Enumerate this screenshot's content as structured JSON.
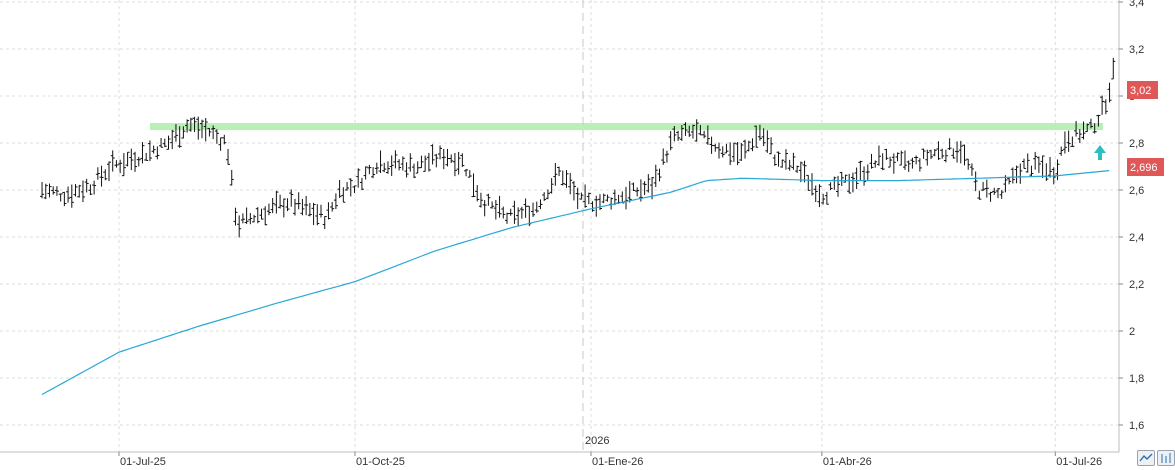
{
  "chart_data": {
    "type": "line",
    "subtype": "ohlc-bars-with-moving-average",
    "title": "",
    "xlabel": "",
    "ylabel": "",
    "ylim": [
      1.5,
      3.4
    ],
    "grid": true,
    "y_axis_side": "right",
    "y_ticks": [
      "1,6",
      "1,8",
      "2",
      "2,2",
      "2,4",
      "2,6",
      "2,8",
      "3",
      "3,2",
      "3,4"
    ],
    "x_ticks": [
      "01-Jul-25",
      "01-Oct-25",
      "01-Ene-26",
      "01-Abr-26",
      "01-Jul-26"
    ],
    "year_marker": "2026",
    "price_anchors": [
      [
        "2025-06-01",
        2.6
      ],
      [
        "2025-06-10",
        2.58
      ],
      [
        "2025-06-20",
        2.62
      ],
      [
        "2025-06-28",
        2.7
      ],
      [
        "2025-07-10",
        2.75
      ],
      [
        "2025-07-20",
        2.8
      ],
      [
        "2025-07-28",
        2.88
      ],
      [
        "2025-08-05",
        2.85
      ],
      [
        "2025-08-12",
        2.8
      ],
      [
        "2025-08-16",
        2.45
      ],
      [
        "2025-08-25",
        2.5
      ],
      [
        "2025-09-05",
        2.55
      ],
      [
        "2025-09-20",
        2.48
      ],
      [
        "2025-09-25",
        2.6
      ],
      [
        "2025-10-01",
        2.62
      ],
      [
        "2025-10-10",
        2.72
      ],
      [
        "2025-10-25",
        2.7
      ],
      [
        "2025-11-05",
        2.75
      ],
      [
        "2025-11-12",
        2.72
      ],
      [
        "2025-11-20",
        2.55
      ],
      [
        "2025-11-30",
        2.48
      ],
      [
        "2025-12-10",
        2.52
      ],
      [
        "2025-12-20",
        2.68
      ],
      [
        "2025-12-28",
        2.55
      ],
      [
        "2026-01-05",
        2.55
      ],
      [
        "2026-01-15",
        2.58
      ],
      [
        "2026-01-25",
        2.62
      ],
      [
        "2026-02-02",
        2.82
      ],
      [
        "2026-02-10",
        2.85
      ],
      [
        "2026-02-20",
        2.78
      ],
      [
        "2026-03-01",
        2.75
      ],
      [
        "2026-03-08",
        2.85
      ],
      [
        "2026-03-15",
        2.72
      ],
      [
        "2026-03-22",
        2.7
      ],
      [
        "2026-04-01",
        2.58
      ],
      [
        "2026-04-05",
        2.6
      ],
      [
        "2026-04-15",
        2.66
      ],
      [
        "2026-04-25",
        2.74
      ],
      [
        "2026-05-05",
        2.7
      ],
      [
        "2026-05-15",
        2.76
      ],
      [
        "2026-05-25",
        2.78
      ],
      [
        "2026-06-01",
        2.6
      ],
      [
        "2026-06-10",
        2.58
      ],
      [
        "2026-06-18",
        2.7
      ],
      [
        "2026-06-25",
        2.7
      ],
      [
        "2026-07-01",
        2.68
      ],
      [
        "2026-07-05",
        2.82
      ],
      [
        "2026-07-15",
        2.86
      ],
      [
        "2026-07-20",
        2.95
      ],
      [
        "2026-07-25",
        3.15
      ],
      [
        "2026-07-30",
        3.28
      ],
      [
        "2026-08-02",
        3.2
      ],
      [
        "2026-08-05",
        3.02
      ]
    ],
    "moving_average_anchors": [
      [
        "2025-06-01",
        1.73
      ],
      [
        "2025-07-01",
        1.91
      ],
      [
        "2025-08-01",
        2.02
      ],
      [
        "2025-09-01",
        2.12
      ],
      [
        "2025-10-01",
        2.21
      ],
      [
        "2025-11-01",
        2.34
      ],
      [
        "2025-12-01",
        2.44
      ],
      [
        "2026-01-01",
        2.52
      ],
      [
        "2026-02-01",
        2.59
      ],
      [
        "2026-02-15",
        2.64
      ],
      [
        "2026-03-01",
        2.65
      ],
      [
        "2026-04-01",
        2.64
      ],
      [
        "2026-05-01",
        2.64
      ],
      [
        "2026-06-01",
        2.65
      ],
      [
        "2026-07-01",
        2.66
      ],
      [
        "2026-08-07",
        2.7
      ]
    ],
    "series": [
      {
        "type": "ohlc",
        "color": "#111111"
      },
      {
        "type": "line",
        "color": "#29a8d6"
      }
    ],
    "annotations": {
      "resistance_line": {
        "value": 2.87,
        "color": "#b9f0b5"
      },
      "up_arrow_color": "#2dbfbf",
      "last_price": {
        "value": 3.02,
        "label": "3,02",
        "color": "#e05757"
      },
      "ma_value": {
        "value": 2.696,
        "label": "2,696",
        "color": "#e05757"
      }
    }
  },
  "toolbar": {
    "icon1": "line-chart-icon",
    "icon2": "bar-chart-icon"
  }
}
